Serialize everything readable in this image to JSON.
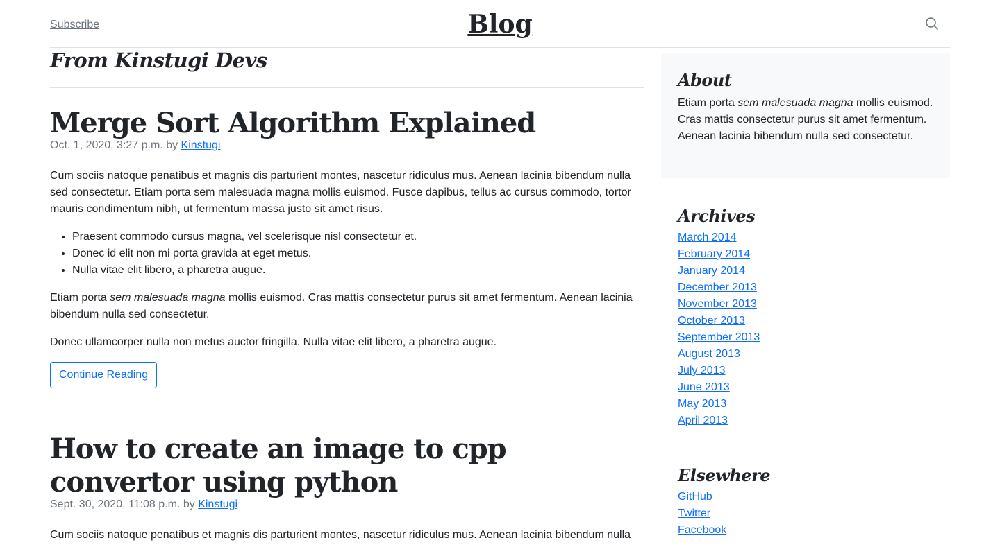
{
  "header": {
    "subscribe_label": "Subscribe",
    "brand": "Blog",
    "search_icon": "search-icon"
  },
  "main": {
    "section_title": "From Kinstugi Devs",
    "posts": [
      {
        "title": "Merge Sort Algorithm Explained",
        "date": "Oct. 1, 2020, 3:27 p.m. by ",
        "author": "Kinstugi",
        "paragraph1": "Cum sociis natoque penatibus et magnis dis parturient montes, nascetur ridiculus mus. Aenean lacinia bibendum nulla sed consectetur. Etiam porta sem malesuada magna mollis euismod. Fusce dapibus, tellus ac cursus commodo, tortor mauris condimentum nibh, ut fermentum massa justo sit amet risus.",
        "bullets": [
          "Praesent commodo cursus magna, vel scelerisque nisl consectetur et.",
          "Donec id elit non mi porta gravida at eget metus.",
          "Nulla vitae elit libero, a pharetra augue."
        ],
        "paragraph2_pre": "Etiam porta ",
        "paragraph2_em": "sem malesuada magna",
        "paragraph2_post": " mollis euismod. Cras mattis consectetur purus sit amet fermentum. Aenean lacinia bibendum nulla sed consectetur.",
        "paragraph3": "Donec ullamcorper nulla non metus auctor fringilla. Nulla vitae elit libero, a pharetra augue.",
        "button_label": "Continue Reading"
      },
      {
        "title": "How to create an image to cpp convertor using python",
        "date": "Sept. 30, 2020, 11:08 p.m. by ",
        "author": "Kinstugi",
        "paragraph1": "Cum sociis natoque penatibus et magnis dis parturient montes, nascetur ridiculus mus. Aenean lacinia bibendum nulla"
      }
    ]
  },
  "sidebar": {
    "about": {
      "title": "About",
      "text_pre": "Etiam porta ",
      "text_em": "sem malesuada magna",
      "text_post": " mollis euismod. Cras mattis consectetur purus sit amet fermentum. Aenean lacinia bibendum nulla sed consectetur."
    },
    "archives": {
      "title": "Archives",
      "items": [
        "March 2014",
        "February 2014",
        "January 2014",
        "December 2013",
        "November 2013",
        "October 2013",
        "September 2013",
        "August 2013",
        "July 2013",
        "June 2013",
        "May 2013",
        "April 2013"
      ]
    },
    "elsewhere": {
      "title": "Elsewhere",
      "items": [
        "GitHub",
        "Twitter",
        "Facebook"
      ]
    }
  },
  "colors": {
    "link": "#0d6efd",
    "text": "#212529",
    "muted": "#6c757d",
    "about_bg": "#f8f9fa",
    "border": "#dee2e6"
  }
}
